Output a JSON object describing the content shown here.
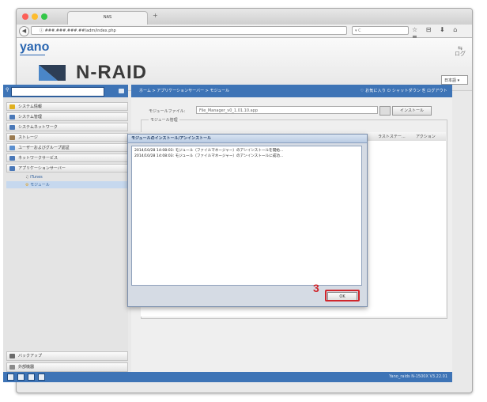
{
  "browser": {
    "tab_title": "NAS",
    "new_tab": "+",
    "back": "◀",
    "url": "ⓘ ###.###.###.##/adm/index.php",
    "search": "▾ C",
    "toolbar_icons": "☆ ⊟ ⬇ ⌂ ≡"
  },
  "header": {
    "company": "yano",
    "product": "N-RAID",
    "logout_icon": "⇆",
    "logout": "ログ",
    "language": "日本語"
  },
  "sidebar": {
    "items": [
      {
        "label": "システム情報",
        "color": "#e0b020"
      },
      {
        "label": "システム管理",
        "color": "#4a78b8"
      },
      {
        "label": "システムネットワーク",
        "color": "#4a78b8"
      },
      {
        "label": "ストレージ",
        "color": "#9a7a50"
      },
      {
        "label": "ユーザーおよびグループ認証",
        "color": "#5b8fcf"
      },
      {
        "label": "ネットワークサービス",
        "color": "#4a78b8"
      },
      {
        "label": "アプリケーションサーバー",
        "color": "#4a78b8"
      }
    ],
    "subitems": [
      {
        "label": "iTunes"
      },
      {
        "label": "モジュール"
      }
    ],
    "bottom": [
      {
        "label": "バックアップ"
      },
      {
        "label": "外部機器"
      }
    ]
  },
  "main": {
    "breadcrumb": "ホーム > アプリケーションサーバー > モジュール",
    "top_links": "♡ お気に入り  ⏻ シャットダウン  ⎘ ログアウト",
    "module_file_label": "モジュールファイル:",
    "module_file_value": "File_Manager_v0_1.01.10.app",
    "install_button": "インストール",
    "section_title": "モジュール管理",
    "columns": [
      "ラストステー...",
      "アクション"
    ],
    "version": "Yano_raids N-1500X V3.22.01"
  },
  "dialog": {
    "title": "モジュールのインストール/アンインストール",
    "log": [
      "2014/10/28 14:08:03: モジュール（ファイルマネージャー）のアンインストールを開始...",
      "2014/10/28 14:08:03: モジュール（ファイルマネージャー）のアンインストールに成功..."
    ],
    "ok_button": "OK"
  },
  "annotation": {
    "step_number": "3",
    "color": "#d0262c"
  }
}
